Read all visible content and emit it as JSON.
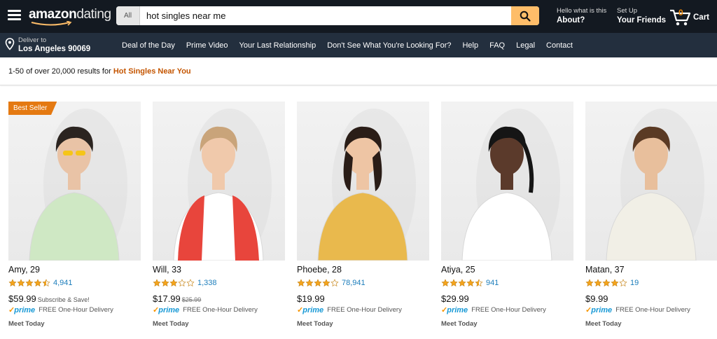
{
  "header": {
    "logo_bold": "amazon",
    "logo_thin": "dating",
    "search_category": "All",
    "search_value": "hot singles near me",
    "hello_line": "Hello what is this",
    "hello_bold": "About?",
    "setup_line": "Set Up",
    "setup_bold": "Your Friends",
    "cart_count": "0",
    "cart_label": "Cart",
    "deliver_line": "Deliver to",
    "deliver_bold": "Los Angeles 90069",
    "accent_color": "#febd69"
  },
  "nav_links": [
    "Deal of the Day",
    "Prime Video",
    "Your Last Relationship",
    "Don't See What You're Looking For?",
    "Help",
    "FAQ",
    "Legal",
    "Contact"
  ],
  "results": {
    "prefix": "1-50 of over 20,000 results for ",
    "query": "Hot Singles Near You"
  },
  "products": [
    {
      "name": "Amy, 29",
      "rating": 4.5,
      "review_count": "4,941",
      "price": "$59.99",
      "price_note": "Subscribe & Save!",
      "old_price": "",
      "badge": "Best Seller",
      "prime": "prime",
      "delivery": "FREE One-Hour Delivery",
      "meet": "Meet Today",
      "shirt_color": "#cfe8c4",
      "hair_color": "#2b2420"
    },
    {
      "name": "Will, 33",
      "rating": 3,
      "review_count": "1,338",
      "price": "$17.99",
      "price_note": "",
      "old_price": "$25.99",
      "badge": "",
      "prime": "prime",
      "delivery": "FREE One-Hour Delivery",
      "meet": "Meet Today",
      "shirt_color": "#ffffff",
      "hair_color": "#c9a47a"
    },
    {
      "name": "Phoebe, 28",
      "rating": 4,
      "review_count": "78,941",
      "price": "$19.99",
      "price_note": "",
      "old_price": "",
      "badge": "",
      "prime": "prime",
      "delivery": "FREE One-Hour Delivery",
      "meet": "Meet Today",
      "shirt_color": "#e9b94d",
      "hair_color": "#2a1d17"
    },
    {
      "name": "Atiya, 25",
      "rating": 4.5,
      "review_count": "941",
      "price": "$29.99",
      "price_note": "",
      "old_price": "",
      "badge": "",
      "prime": "prime",
      "delivery": "FREE One-Hour Delivery",
      "meet": "Meet Today",
      "shirt_color": "#ffffff",
      "hair_color": "#151515"
    },
    {
      "name": "Matan, 37",
      "rating": 4,
      "review_count": "19",
      "price": "$9.99",
      "price_note": "",
      "old_price": "",
      "badge": "",
      "prime": "prime",
      "delivery": "FREE One-Hour Delivery",
      "meet": "Meet Today",
      "shirt_color": "#f1efe6",
      "hair_color": "#5a3a24"
    }
  ],
  "colors": {
    "nav_dark": "#131921",
    "nav_mid": "#232f3e",
    "link_blue": "#1c7dbb",
    "star_orange": "#f4a41c",
    "badge_orange": "#e47911",
    "query_orange": "#c45500"
  }
}
